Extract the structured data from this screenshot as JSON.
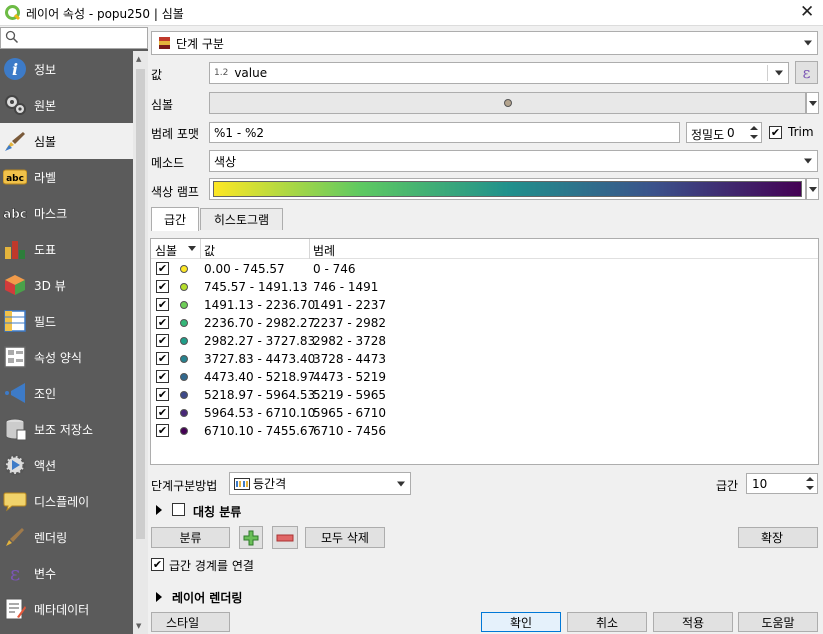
{
  "window": {
    "title": "레이어 속성 - popu250 | 심볼",
    "close": "✕"
  },
  "sidebar": {
    "search_placeholder": "",
    "items": [
      {
        "label": "정보",
        "icon": "info-icon"
      },
      {
        "label": "원본",
        "icon": "source-icon"
      },
      {
        "label": "심볼",
        "icon": "symbology-icon"
      },
      {
        "label": "라벨",
        "icon": "label-icon"
      },
      {
        "label": "마스크",
        "icon": "mask-icon"
      },
      {
        "label": "도표",
        "icon": "diagram-icon"
      },
      {
        "label": "3D 뷰",
        "icon": "3d-view-icon"
      },
      {
        "label": "필드",
        "icon": "fields-icon"
      },
      {
        "label": "속성 양식",
        "icon": "attributes-form-icon"
      },
      {
        "label": "조인",
        "icon": "join-icon"
      },
      {
        "label": "보조 저장소",
        "icon": "auxiliary-storage-icon"
      },
      {
        "label": "액션",
        "icon": "actions-icon"
      },
      {
        "label": "디스플레이",
        "icon": "display-icon"
      },
      {
        "label": "렌더링",
        "icon": "rendering-icon"
      },
      {
        "label": "변수",
        "icon": "variables-icon"
      },
      {
        "label": "메타데이터",
        "icon": "metadata-icon"
      }
    ],
    "active_index": 2
  },
  "renderer": {
    "label": "단계 구분"
  },
  "value": {
    "label": "값",
    "type_badge": "1.2",
    "field": "value",
    "expr_button": "ε"
  },
  "symbol": {
    "label": "심볼",
    "color": "#b4a48e"
  },
  "legend_format": {
    "label": "범례 포맷",
    "value": "%1 - %2",
    "precision_label": "정밀도",
    "precision_value": "0",
    "trim_label": "Trim",
    "trim_checked": true
  },
  "method": {
    "label": "메소드",
    "value": "색상"
  },
  "color_ramp": {
    "label": "색상 램프",
    "stops": [
      "#fde725",
      "#5ec962",
      "#21918c",
      "#3b528b",
      "#440154"
    ]
  },
  "tabs": [
    {
      "label": "급간",
      "active": true
    },
    {
      "label": "히스토그램",
      "active": false
    }
  ],
  "table": {
    "headers": {
      "symbol": "심볼",
      "values": "값",
      "legend": "범례"
    },
    "rows": [
      {
        "checked": true,
        "color": "#fde725",
        "value": "0.00 - 745.57",
        "legend": "0 - 746"
      },
      {
        "checked": true,
        "color": "#b5de2b",
        "value": "745.57 - 1491.13",
        "legend": "746 - 1491"
      },
      {
        "checked": true,
        "color": "#6ece58",
        "value": "1491.13 - 2236.70",
        "legend": "1491 - 2237"
      },
      {
        "checked": true,
        "color": "#35b779",
        "value": "2236.70 - 2982.27",
        "legend": "2237 - 2982"
      },
      {
        "checked": true,
        "color": "#1f9e89",
        "value": "2982.27 - 3727.83",
        "legend": "2982 - 3728"
      },
      {
        "checked": true,
        "color": "#26828e",
        "value": "3727.83 - 4473.40",
        "legend": "3728 - 4473"
      },
      {
        "checked": true,
        "color": "#31688e",
        "value": "4473.40 - 5218.97",
        "legend": "4473 - 5219"
      },
      {
        "checked": true,
        "color": "#3e4989",
        "value": "5218.97 - 5964.53",
        "legend": "5219 - 5965"
      },
      {
        "checked": true,
        "color": "#482878",
        "value": "5964.53 - 6710.10",
        "legend": "5965 - 6710"
      },
      {
        "checked": true,
        "color": "#440154",
        "value": "6710.10 - 7455.67",
        "legend": "6710 - 7456"
      }
    ]
  },
  "classification": {
    "mode_label": "단계구분방법",
    "mode_value": "등간격",
    "classes_label": "급간",
    "classes_value": "10"
  },
  "symmetric": {
    "label": "대칭 분류",
    "checked": false
  },
  "actions": {
    "classify": "분류",
    "add": "+",
    "remove": "−",
    "delete_all": "모두 삭제",
    "advanced": "확장"
  },
  "link_boundaries": {
    "label": "급간 경계를 연결",
    "checked": true
  },
  "layer_rendering": {
    "label": "레이어 렌더링"
  },
  "footer": {
    "style": "스타일",
    "ok": "확인",
    "cancel": "취소",
    "apply": "적용",
    "help": "도움말"
  }
}
